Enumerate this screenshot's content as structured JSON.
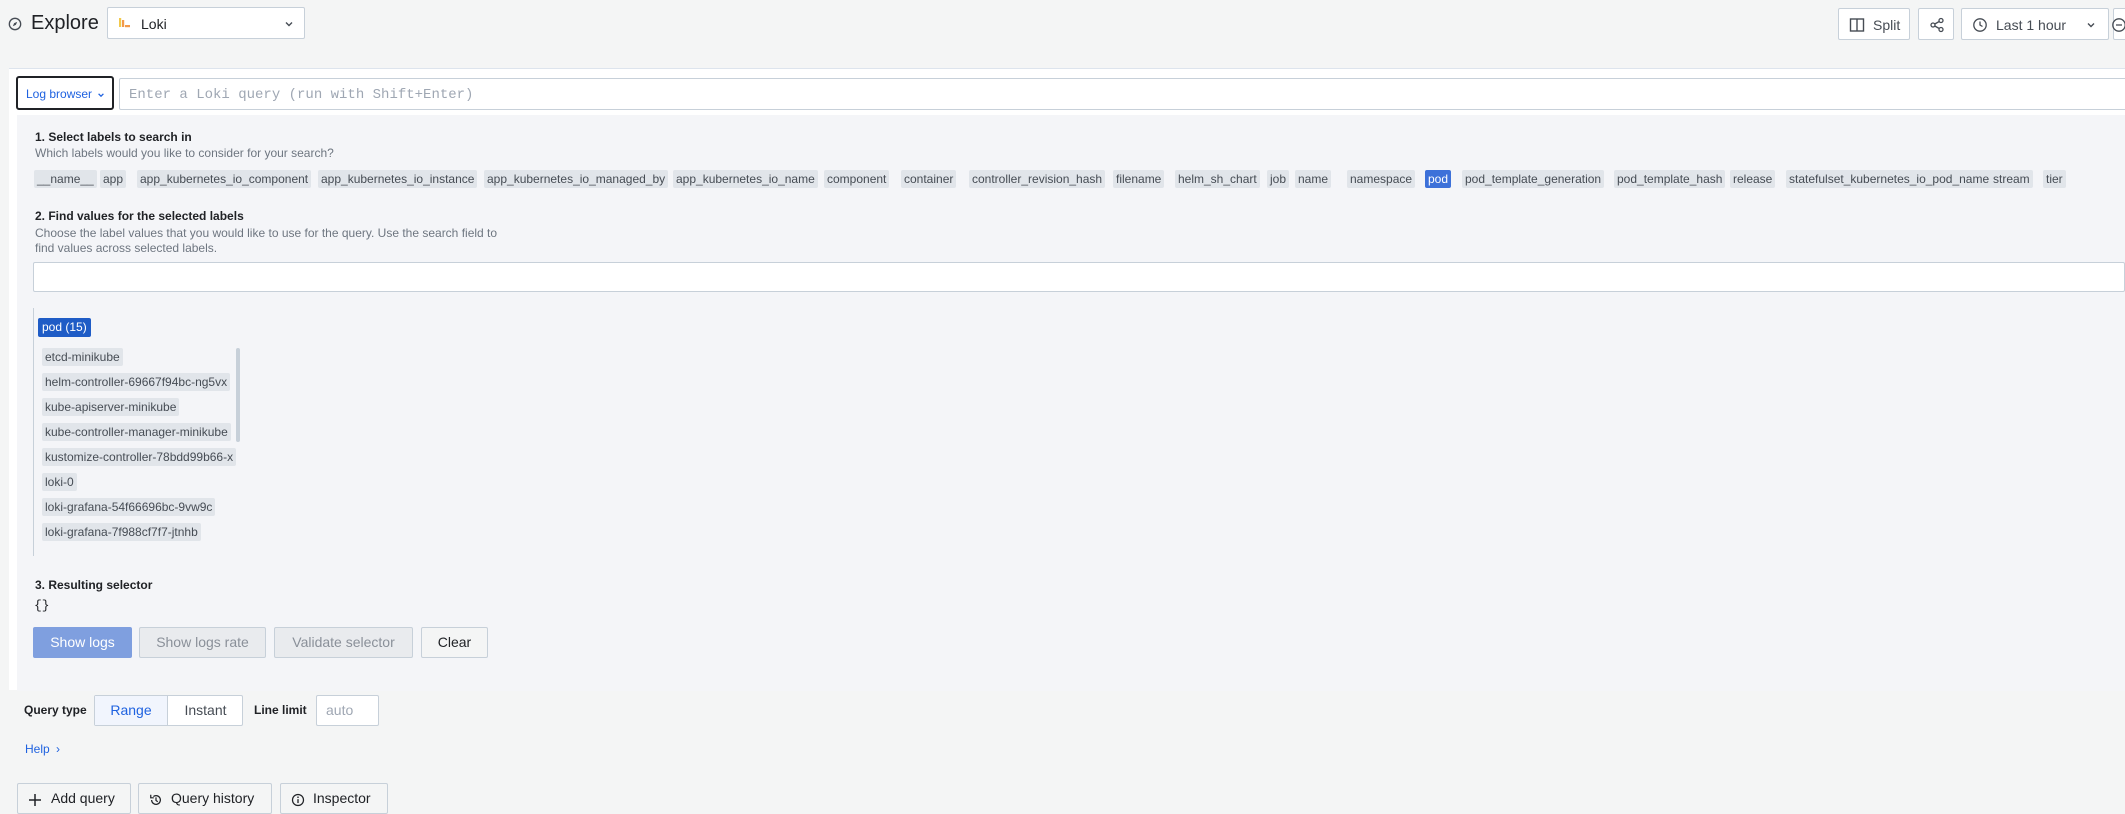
{
  "header": {
    "title": "Explore",
    "datasource": "Loki",
    "split_label": "Split",
    "time_range": "Last 1 hour"
  },
  "query": {
    "log_browser_label": "Log browser",
    "placeholder": "Enter a Loki query (run with Shift+Enter)"
  },
  "browser": {
    "step1_title": "1. Select labels to search in",
    "step1_desc": "Which labels would you like to consider for your search?",
    "labels": [
      "__name__",
      "app",
      "app_kubernetes_io_component",
      "app_kubernetes_io_instance",
      "app_kubernetes_io_managed_by",
      "app_kubernetes_io_name",
      "component",
      "container",
      "controller_revision_hash",
      "filename",
      "helm_sh_chart",
      "job",
      "name",
      "namespace",
      "pod",
      "pod_template_generation",
      "pod_template_hash",
      "release",
      "statefulset_kubernetes_io_pod_name",
      "stream",
      "tier"
    ],
    "selected_label": "pod",
    "step2_title": "2. Find values for the selected labels",
    "step2_desc_line1": "Choose the label values that you would like to use for the query. Use the search field to",
    "step2_desc_line2": "find values across selected labels.",
    "values_header": "pod (15)",
    "values": [
      "etcd-minikube",
      "helm-controller-69667f94bc-ng5vx",
      "kube-apiserver-minikube",
      "kube-controller-manager-minikube",
      "kustomize-controller-78bdd99b66-x",
      "loki-0",
      "loki-grafana-54f66696bc-9vw9c",
      "loki-grafana-7f988cf7f7-jtnhb"
    ],
    "step3_title": "3. Resulting selector",
    "selector": "{}",
    "show_logs": "Show logs",
    "show_logs_rate": "Show logs rate",
    "validate_selector": "Validate selector",
    "clear": "Clear"
  },
  "options": {
    "query_type_label": "Query type",
    "range": "Range",
    "instant": "Instant",
    "line_limit_label": "Line limit",
    "line_limit_placeholder": "auto",
    "active_query_type": "Range"
  },
  "help_label": "Help",
  "footer": {
    "add_query": "Add query",
    "query_history": "Query history",
    "inspector": "Inspector"
  },
  "colors": {
    "accent": "#1f62e0",
    "selected_chip": "#3d71d9",
    "primary_button": "#7f9fdf"
  }
}
